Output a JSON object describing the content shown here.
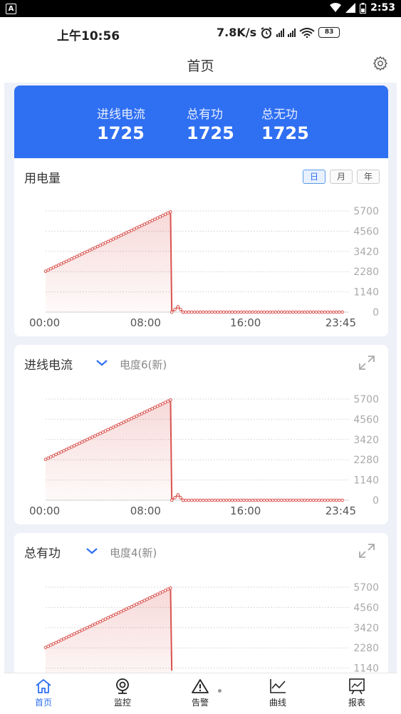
{
  "system_bar": {
    "time": "2:53"
  },
  "device_status": {
    "time": "上午10:56",
    "speed": "7.8K/s",
    "battery": "83"
  },
  "header": {
    "title": "首页"
  },
  "summary": [
    {
      "label": "进线电流",
      "value": "1725"
    },
    {
      "label": "总有功",
      "value": "1725"
    },
    {
      "label": "总无功",
      "value": "1725"
    }
  ],
  "energy_card": {
    "title": "用电量",
    "periods": [
      "日",
      "月",
      "年"
    ],
    "selected_period": "日"
  },
  "current_card": {
    "title": "进线电流",
    "meter": "电度6(新)"
  },
  "power_card": {
    "title": "总有功",
    "meter": "电度4(新)"
  },
  "chart_data": [
    {
      "type": "area",
      "title": "用电量",
      "x_ticks": [
        "00:00",
        "08:00",
        "16:00",
        "23:45"
      ],
      "y_ticks": [
        "5700",
        "4560",
        "3420",
        "2280",
        "1140",
        "0"
      ],
      "ylim": [
        0,
        5700
      ],
      "xlim": [
        0,
        24
      ],
      "x": [
        0,
        10,
        10.1,
        10.6,
        11,
        23.75
      ],
      "y": [
        2300,
        5650,
        0,
        300,
        0,
        0
      ],
      "grid": true,
      "color": "#d9534f"
    },
    {
      "type": "area",
      "title": "进线电流",
      "x_ticks": [
        "00:00",
        "08:00",
        "16:00",
        "23:45"
      ],
      "y_ticks": [
        "5700",
        "4560",
        "3420",
        "2280",
        "1140",
        "0"
      ],
      "ylim": [
        0,
        5700
      ],
      "xlim": [
        0,
        24
      ],
      "x": [
        0,
        10,
        10.1,
        10.6,
        11,
        23.75
      ],
      "y": [
        2300,
        5650,
        0,
        300,
        0,
        0
      ],
      "grid": true,
      "color": "#d9534f"
    },
    {
      "type": "area",
      "title": "总有功",
      "x_ticks": [],
      "y_ticks": [
        "5700",
        "4560",
        "3420",
        "2280",
        "1140"
      ],
      "ylim": [
        0,
        5700
      ],
      "xlim": [
        0,
        24
      ],
      "x": [
        0,
        10,
        10.1
      ],
      "y": [
        2300,
        5650,
        1000
      ],
      "grid": true,
      "color": "#d9534f"
    }
  ],
  "tabs": [
    {
      "label": "首页",
      "icon": "home-icon",
      "active": true
    },
    {
      "label": "监控",
      "icon": "camera-icon",
      "active": false
    },
    {
      "label": "告警",
      "icon": "warning-icon",
      "active": false
    },
    {
      "label": "曲线",
      "icon": "line-chart-icon",
      "active": false
    },
    {
      "label": "报表",
      "icon": "report-icon",
      "active": false
    }
  ]
}
